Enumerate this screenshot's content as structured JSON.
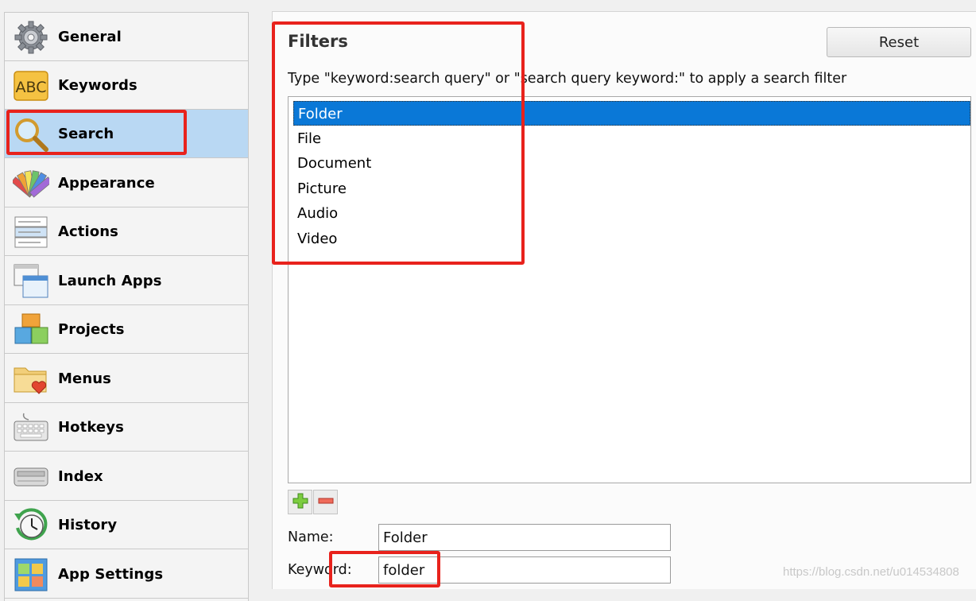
{
  "sidebar": {
    "items": [
      {
        "label": "General",
        "icon": "gear-icon",
        "selected": false
      },
      {
        "label": "Keywords",
        "icon": "abc-icon",
        "selected": false
      },
      {
        "label": "Search",
        "icon": "magnifier-icon",
        "selected": true
      },
      {
        "label": "Appearance",
        "icon": "palette-icon",
        "selected": false
      },
      {
        "label": "Actions",
        "icon": "actions-list-icon",
        "selected": false
      },
      {
        "label": "Launch Apps",
        "icon": "windows-icon",
        "selected": false
      },
      {
        "label": "Projects",
        "icon": "blocks-icon",
        "selected": false
      },
      {
        "label": "Menus",
        "icon": "folder-heart-icon",
        "selected": false
      },
      {
        "label": "Hotkeys",
        "icon": "keyboard-icon",
        "selected": false
      },
      {
        "label": "Index",
        "icon": "drive-icon",
        "selected": false
      },
      {
        "label": "History",
        "icon": "clock-icon",
        "selected": false
      },
      {
        "label": "App Settings",
        "icon": "app-settings-icon",
        "selected": false
      }
    ]
  },
  "main": {
    "title": "Filters",
    "reset_label": "Reset",
    "hint": "Type \"keyword:search query\" or \"search query keyword:\" to apply a search filter",
    "filters": [
      {
        "label": "Folder",
        "selected": true
      },
      {
        "label": "File",
        "selected": false
      },
      {
        "label": "Document",
        "selected": false
      },
      {
        "label": "Picture",
        "selected": false
      },
      {
        "label": "Audio",
        "selected": false
      },
      {
        "label": "Video",
        "selected": false
      }
    ],
    "name_label": "Name:",
    "name_value": "Folder",
    "keyword_label": "Keyword:",
    "keyword_value": "folder"
  },
  "watermark": "https://blog.csdn.net/u014534808",
  "colors": {
    "selection": "#0a78d7",
    "sidebar_selected": "#b9d8f3",
    "highlight_box": "#e8221c"
  }
}
